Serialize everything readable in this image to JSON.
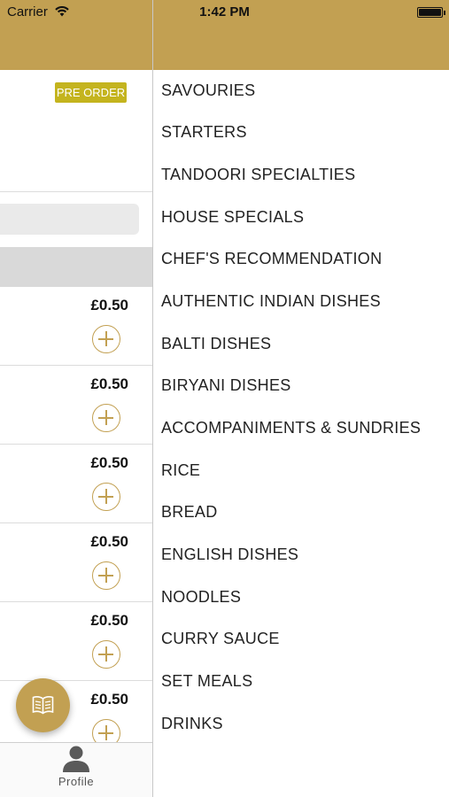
{
  "status_bar": {
    "carrier": "Carrier",
    "time": "1:42 PM"
  },
  "colors": {
    "accent": "#c2a052",
    "pre_order_badge": "#c4b41e"
  },
  "left_panel": {
    "pre_order_label": "PRE ORDER",
    "items": [
      {
        "price": "£0.50"
      },
      {
        "price": "£0.50"
      },
      {
        "price": "£0.50"
      },
      {
        "price": "£0.50"
      },
      {
        "price": "£0.50"
      },
      {
        "price": "£0.50"
      }
    ],
    "fab_icon": "menu-book-icon"
  },
  "tab_bar": {
    "profile_label": "Profile",
    "profile_icon": "person-icon"
  },
  "categories": [
    "SAVOURIES",
    "STARTERS",
    "TANDOORI SPECIALTIES",
    "HOUSE SPECIALS",
    "CHEF'S RECOMMENDATION",
    "AUTHENTIC INDIAN DISHES",
    "BALTI DISHES",
    "BIRYANI DISHES",
    "ACCOMPANIMENTS & SUNDRIES",
    "RICE",
    "BREAD",
    "ENGLISH DISHES",
    "NOODLES",
    "CURRY SAUCE",
    "SET MEALS",
    "DRINKS"
  ]
}
